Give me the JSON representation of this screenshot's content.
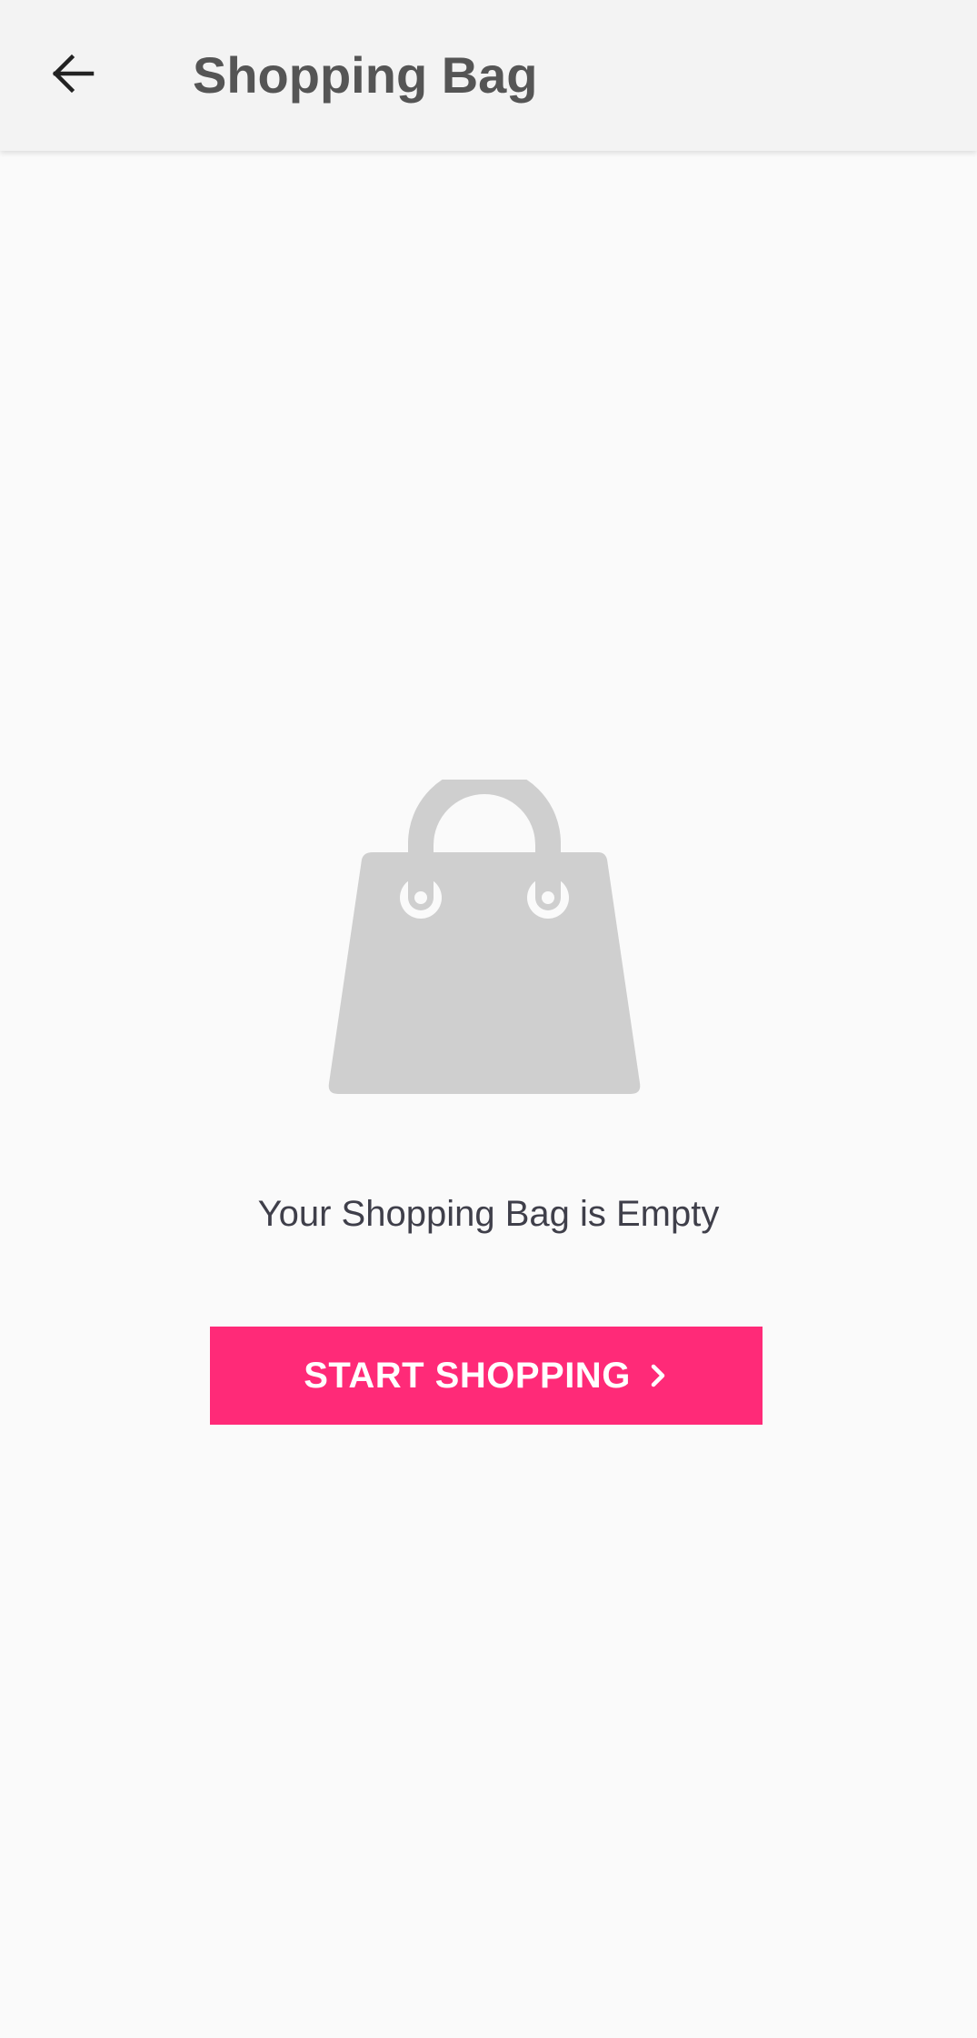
{
  "header": {
    "title": "Shopping Bag",
    "back_icon": "arrow-left-icon"
  },
  "empty_state": {
    "illustration_icon": "shopping-bag-icon",
    "message": "Your Shopping Bag is Empty",
    "cta_label": "START SHOPPING",
    "cta_icon": "chevron-right-icon"
  },
  "colors": {
    "accent": "#ff2a78",
    "app_bar": "#f3f3f3",
    "background": "#fafafa",
    "illustration": "#cfcfcf",
    "title_text": "#555555",
    "message_text": "#3f3f4a"
  }
}
